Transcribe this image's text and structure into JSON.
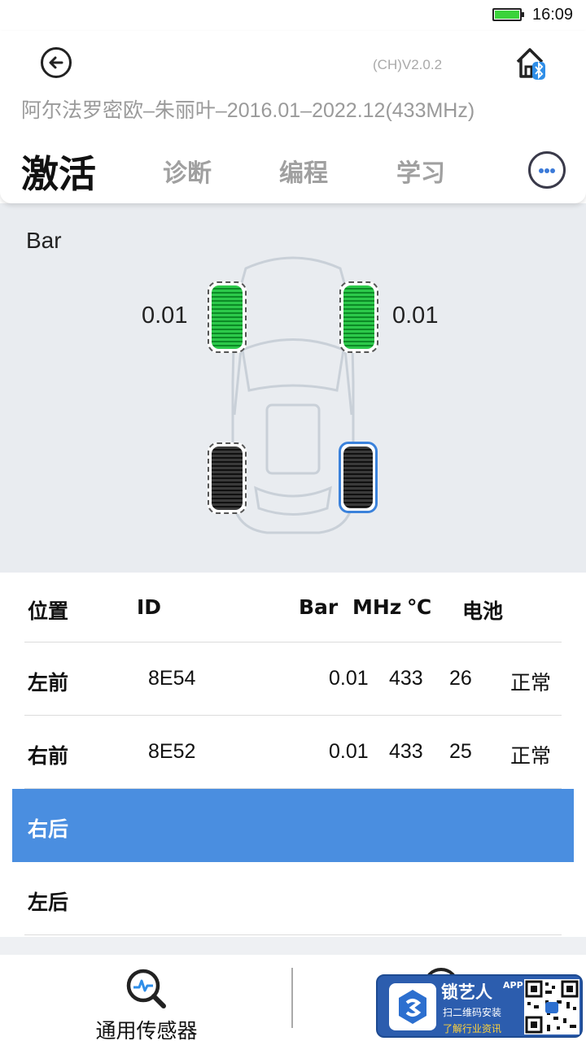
{
  "status_bar": {
    "time": "16:09",
    "battery_icon": "battery-charging-icon"
  },
  "header": {
    "back_icon": "back-arrow-icon",
    "version": "(CH)V2.0.2",
    "home_icon": "home-bluetooth-icon",
    "vehicle": "阿尔法罗密欧–朱丽叶–2016.01–2022.12(433MHz)",
    "tabs": [
      {
        "label": "激活",
        "active": true
      },
      {
        "label": "诊断",
        "active": false
      },
      {
        "label": "编程",
        "active": false
      },
      {
        "label": "学习",
        "active": false
      }
    ],
    "more_icon": "more-dots-icon"
  },
  "diagram": {
    "unit": "Bar",
    "tires": {
      "front_left": {
        "pressure": "0.01",
        "state": "activated"
      },
      "front_right": {
        "pressure": "0.01",
        "state": "activated"
      },
      "rear_left": {
        "pressure": "",
        "state": "inactive"
      },
      "rear_right": {
        "pressure": "",
        "state": "selected"
      }
    },
    "colors": {
      "activated": "#22b843",
      "inactive": "#1e1e1e",
      "selected": "#3b82db"
    }
  },
  "table": {
    "headers": {
      "position": "位置",
      "id": "ID",
      "bar": "Bar",
      "mhz": "MHz",
      "temp": "℃",
      "battery": "电池"
    },
    "rows": [
      {
        "position": "左前",
        "id": "8E54",
        "bar": "0.01",
        "mhz": "433",
        "temp": "26",
        "battery": "正常"
      },
      {
        "position": "右前",
        "id": "8E52",
        "bar": "0.01",
        "mhz": "433",
        "temp": "25",
        "battery": "正常"
      },
      {
        "position": "右后",
        "id": "",
        "bar": "",
        "mhz": "",
        "temp": "",
        "battery": "",
        "selected": true
      },
      {
        "position": "左后",
        "id": "",
        "bar": "",
        "mhz": "",
        "temp": "",
        "battery": ""
      }
    ],
    "highlight_color": "#4a8ee0"
  },
  "bottom_bar": {
    "universal_sensor_label": "通用传感器",
    "universal_sensor_icon": "search-sensor-icon"
  },
  "ad": {
    "brand": "锁艺人",
    "app": "APP",
    "line1": "扫二维码安装",
    "line2": "了解行业资讯",
    "qr_icon": "qr-code-icon"
  }
}
